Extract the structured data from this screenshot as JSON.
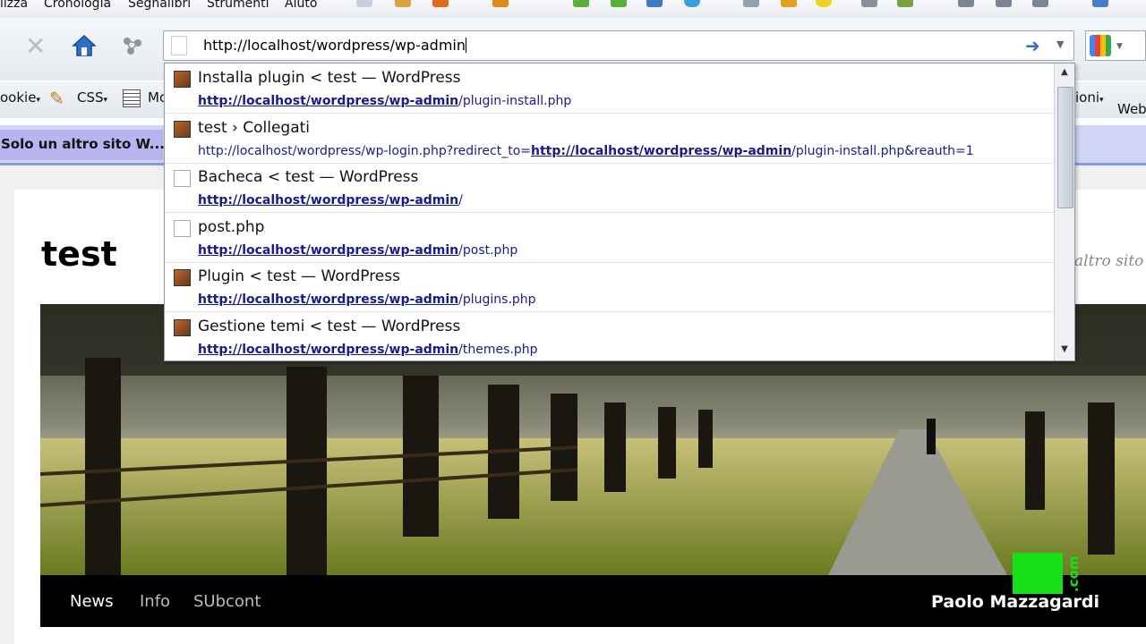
{
  "menubar": {
    "items": [
      "lizza",
      "Cronologia",
      "Segnalibri",
      "Strumenti",
      "Aiuto"
    ]
  },
  "navbar": {
    "url": "http://localhost/wordpress/wp-admin"
  },
  "bookmarks": {
    "items": [
      "ookie",
      "CSS",
      "Mo",
      "ioni",
      "Web"
    ]
  },
  "tab": {
    "label": "Solo un altro sito W..."
  },
  "dropdown": {
    "rows": [
      {
        "title": "Installa plugin < test — WordPress",
        "url_pre": "",
        "url_bold": "http://localhost/wordpress/wp-admin",
        "url_post": "/plugin-install.php",
        "icon": "wordpress-favicon-icon"
      },
      {
        "title": "test › Collegati",
        "url_pre": "http://localhost/wordpress/wp-login.php?redirect_to=",
        "url_bold": "http://localhost/wordpress/wp-admin",
        "url_post": "/plugin-install.php&reauth=1",
        "icon": "wordpress-favicon-icon"
      },
      {
        "title": "Bacheca < test — WordPress",
        "url_pre": "",
        "url_bold": "http://localhost/wordpress/wp-admin",
        "url_post": "/",
        "icon": "blank-page-icon"
      },
      {
        "title": "post.php",
        "url_pre": "",
        "url_bold": "http://localhost/wordpress/wp-admin",
        "url_post": "/post.php",
        "icon": "blank-page-icon"
      },
      {
        "title": "Plugin < test — WordPress",
        "url_pre": "",
        "url_bold": "http://localhost/wordpress/wp-admin",
        "url_post": "/plugins.php",
        "icon": "wordpress-favicon-icon"
      },
      {
        "title": "Gestione temi < test — WordPress",
        "url_pre": "",
        "url_bold": "http://localhost/wordpress/wp-admin",
        "url_post": "/themes.php",
        "icon": "wordpress-favicon-icon"
      }
    ]
  },
  "site": {
    "title": "test",
    "tagline": "altro sito W",
    "nav": [
      "News",
      "Info",
      "SUbcont"
    ]
  },
  "watermark": {
    "name": "Paolo Mazzagardi",
    "logo_text": ".com"
  },
  "colors": {
    "tab": "#b9b4f0",
    "link": "#1a1a8a",
    "logo": "#18e018"
  }
}
